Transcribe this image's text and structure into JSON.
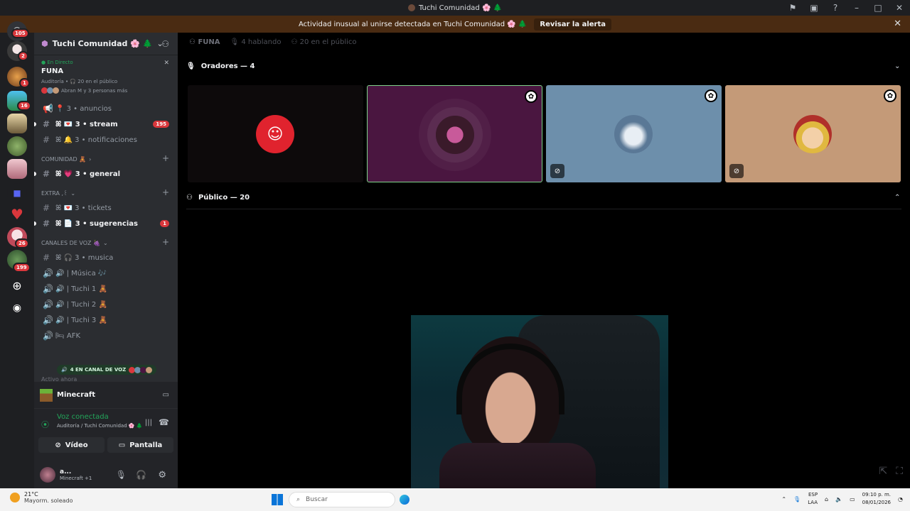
{
  "window": {
    "title": "Tuchi Comunidad 🌸 🌲"
  },
  "alert": {
    "message": "Actividad inusual al unirse detectada en Tuchi Comunidad 🌸 🌲",
    "action": "Revisar la alerta"
  },
  "rail": {
    "badges": [
      "105",
      "2",
      "1",
      "16",
      "26",
      "199"
    ]
  },
  "server": {
    "name": "Tuchi Comunidad 🌸 🌲",
    "live": {
      "tag": "En Directo",
      "name": "FUNA",
      "meta": "Auditoría • 🎧 20 en el público",
      "avatars_text": "Abran M y 3 personas más"
    },
    "channels": [
      {
        "icon": "📢",
        "label": "📍 3 • anuncios",
        "bold": false
      },
      {
        "icon": "#",
        "label": "ꕤ 💌 3 • stream",
        "bold": true,
        "count": "195"
      },
      {
        "icon": "#",
        "label": "ꕤ 🔔 3 • notificaciones",
        "bold": false
      }
    ],
    "cat_comunidad": "COMUNIDAD 🧸",
    "channels_comunidad": [
      {
        "icon": "#",
        "label": "ꕤ 💗 3 • general",
        "bold": true
      }
    ],
    "cat_extra": "EXTRA ,꒰",
    "channels_extra": [
      {
        "icon": "#",
        "label": "ꕤ 💌 3 • tickets",
        "bold": false
      },
      {
        "icon": "#",
        "label": "ꕤ 📄 3 • sugerencias",
        "bold": true,
        "count": "1"
      }
    ],
    "cat_voz": "CANALES DE VOZ 🍇",
    "channels_voz": [
      {
        "icon": "#",
        "label": "ꕤ 🎧 3 • musica"
      },
      {
        "icon": "🔊",
        "label": "🔊 | Música 🎶"
      },
      {
        "icon": "🔊",
        "label": "🔊 | Tuchi 1 🧸"
      },
      {
        "icon": "🔊",
        "label": "🔊 | Tuchi 2 🧸"
      },
      {
        "icon": "🔊",
        "label": "🔊 | Tuchi 3 🧸"
      },
      {
        "icon": "🔊",
        "label": "🛏 AFK"
      }
    ],
    "vc_pill": "4 EN CANAL DE VOZ",
    "active_now": "Activo ahora"
  },
  "panel": {
    "activity": "Minecraft",
    "voice_title": "Voz conectada",
    "voice_sub": "Auditoría / Tuchi Comunidad 🌸 🌲",
    "video_label": "Vídeo",
    "screen_label": "Pantalla",
    "user_name": "a...",
    "user_status": "Minecraft +1"
  },
  "stage": {
    "channel_name": "FUNA",
    "speaking": "4 hablando",
    "audience": "20 en el público",
    "speakers_title": "Oradores — 4",
    "audience_title": "Público — 20"
  },
  "taskbar": {
    "temp": "21°C",
    "weather": "Mayorm. soleado",
    "search_placeholder": "Buscar",
    "lang1": "ESP",
    "lang2": "LAA",
    "time": "09:10 p. m.",
    "date": "08/01/2026"
  },
  "colors": {
    "discord_red": "#e0232e",
    "tile_purple": "#4a1640",
    "tile_blue": "#6d8fab",
    "tile_tan": "#c49a78",
    "online_green": "#23a55a"
  }
}
